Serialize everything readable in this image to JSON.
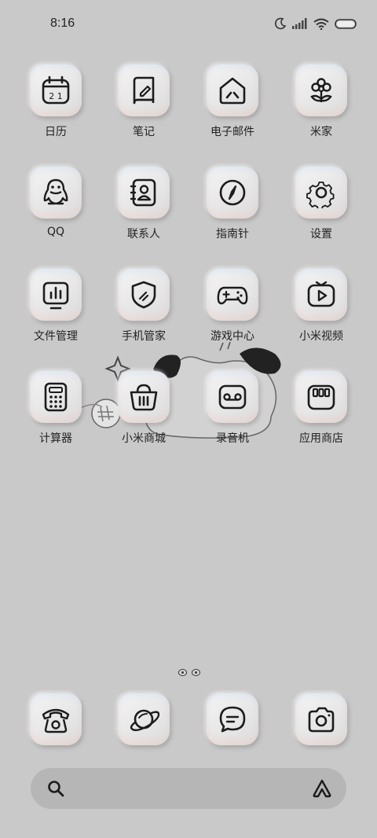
{
  "status_bar": {
    "time": "8:16",
    "icons": [
      "moon-icon",
      "signal-icon",
      "wifi-icon",
      "battery-icon"
    ]
  },
  "home": {
    "apps": [
      {
        "label": "日历",
        "icon": "calendar-icon",
        "calendar_digits": "2 1"
      },
      {
        "label": "笔记",
        "icon": "notes-icon"
      },
      {
        "label": "电子邮件",
        "icon": "email-icon"
      },
      {
        "label": "米家",
        "icon": "mijia-icon"
      },
      {
        "label": "QQ",
        "icon": "qq-penguin-icon"
      },
      {
        "label": "联系人",
        "icon": "contacts-icon"
      },
      {
        "label": "指南针",
        "icon": "compass-icon"
      },
      {
        "label": "设置",
        "icon": "settings-gear-icon"
      },
      {
        "label": "文件管理",
        "icon": "file-manager-icon"
      },
      {
        "label": "手机管家",
        "icon": "security-shield-icon"
      },
      {
        "label": "游戏中心",
        "icon": "gamepad-icon"
      },
      {
        "label": "小米视频",
        "icon": "video-play-icon"
      },
      {
        "label": "计算器",
        "icon": "calculator-icon"
      },
      {
        "label": "小米商城",
        "icon": "shopping-basket-icon"
      },
      {
        "label": "录音机",
        "icon": "recorder-icon"
      },
      {
        "label": "应用商店",
        "icon": "app-store-icon"
      }
    ]
  },
  "pages": {
    "count": 2,
    "current": 1
  },
  "dock": {
    "apps": [
      {
        "name": "phone",
        "icon": "telephone-icon"
      },
      {
        "name": "browser",
        "icon": "planet-browser-icon"
      },
      {
        "name": "messages",
        "icon": "message-bubble-icon"
      },
      {
        "name": "camera",
        "icon": "camera-icon"
      }
    ]
  },
  "search_bar": {
    "icons": [
      "search-icon",
      "assistant-logo-icon"
    ]
  },
  "colors": {
    "background": "#c9c9c9",
    "tile": "#ececec",
    "search_bar": "#b6b6b6",
    "icon_stroke": "#1c1c1c"
  }
}
